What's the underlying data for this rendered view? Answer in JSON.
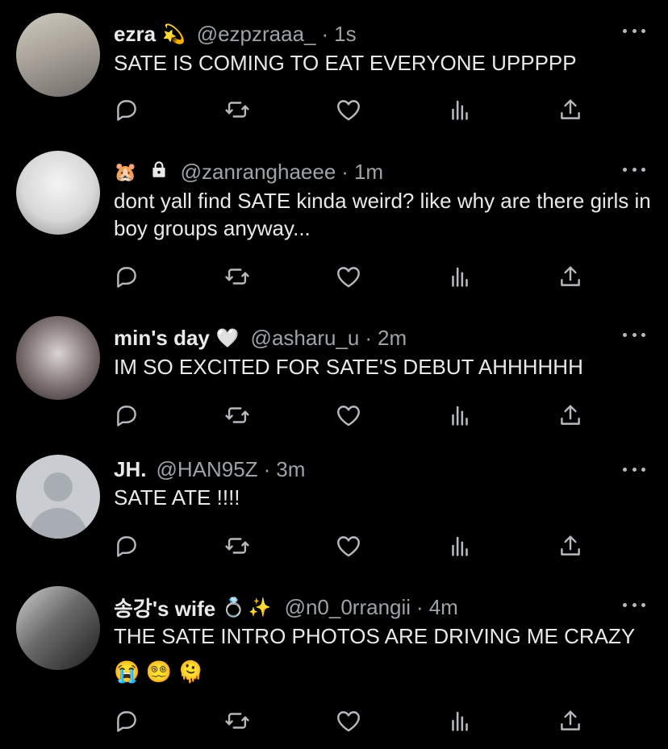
{
  "tweets": [
    {
      "display_name": "ezra",
      "emojis": [
        "💫"
      ],
      "handle": "@ezpzraaa_",
      "separator": "·",
      "time": "1s",
      "text": "SATE IS COMING TO EAT EVERYONE UPPPPP",
      "avatar": "profile-photo"
    },
    {
      "display_name": "",
      "emojis": [
        "🐹"
      ],
      "locked": true,
      "handle": "@zanranghaeee",
      "separator": "·",
      "time": "1m",
      "text": "dont yall find SATE kinda weird? like why are there girls in boy groups anyway...",
      "avatar": "profile-photo"
    },
    {
      "display_name": "min's day",
      "emojis": [
        "🤍"
      ],
      "handle": "@asharu_u",
      "separator": "·",
      "time": "2m",
      "text": "IM SO EXCITED FOR SATE'S DEBUT AHHHHHH",
      "avatar": "profile-photo"
    },
    {
      "display_name": "JH.",
      "emojis": [],
      "handle": "@HAN95Z",
      "separator": "·",
      "time": "3m",
      "text": "SATE ATE !!!!",
      "avatar": "default-avatar"
    },
    {
      "display_name": "송강's wife",
      "emojis": [
        "💍",
        "✨"
      ],
      "handle": "@n0_0rrangii",
      "separator": "·",
      "time": "4m",
      "text": "THE SATE INTRO PHOTOS ARE DRIVING ME CRAZY 😭 😵‍💫 🫠",
      "avatar": "profile-photo"
    }
  ],
  "icons": {
    "reply": "reply-icon",
    "retweet": "retweet-icon",
    "like": "like-icon",
    "views": "views-icon",
    "share": "share-icon",
    "more": "more-options-icon",
    "lock": "lock-icon"
  },
  "colors": {
    "background": "#000000",
    "text": "#e7e9ea",
    "secondary_text": "#9ea3a8",
    "icon": "#b6babe"
  }
}
